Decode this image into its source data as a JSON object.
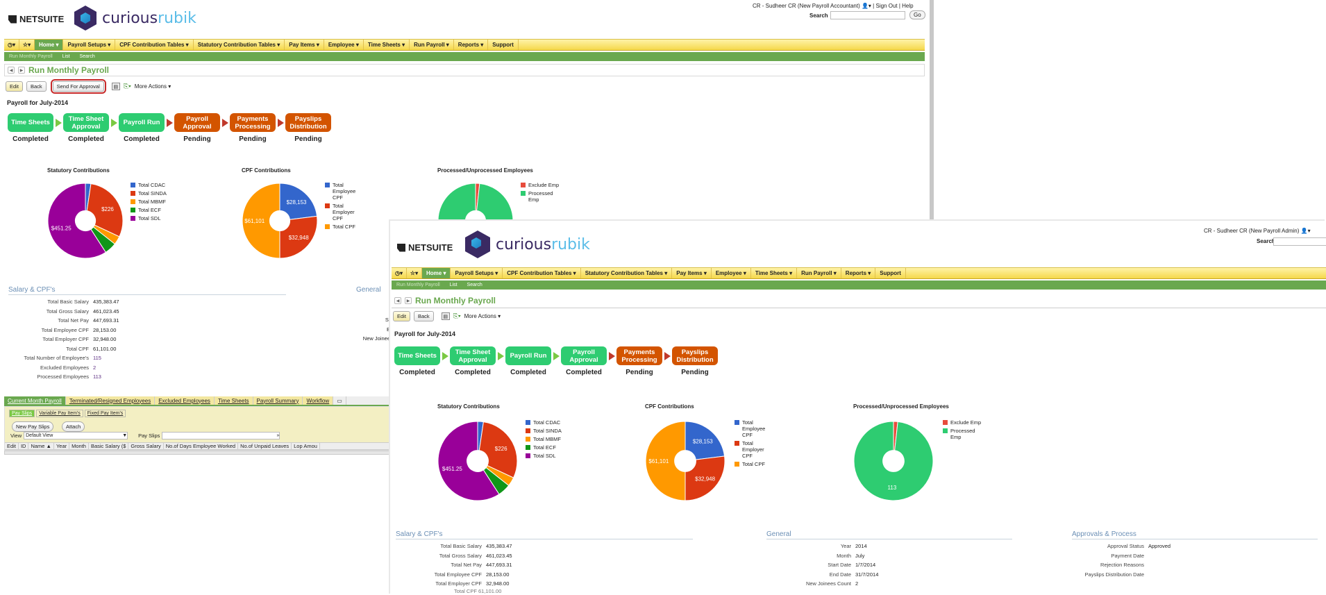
{
  "app": {
    "netsuite_label": "NETSUITE",
    "brand_left": "curious",
    "brand_right": "rubik"
  },
  "win1": {
    "user": "CR - Sudheer CR (New Payroll Accountant)",
    "sign_out": "Sign Out",
    "help": "Help",
    "search_label": "Search",
    "go": "Go"
  },
  "win2": {
    "user": "CR - Sudheer CR (New Payroll Admin)",
    "search_label": "Search"
  },
  "menu": {
    "home": "Home ▾",
    "items": [
      "Payroll Setups ▾",
      "CPF Contribution Tables ▾",
      "Statutory Contribution Tables ▾",
      "Pay Items ▾",
      "Employee ▾",
      "Time Sheets ▾",
      "Run Payroll ▾",
      "Reports ▾",
      "Support"
    ]
  },
  "submenu": {
    "current": "Run Monthly Payroll",
    "list": "List",
    "search": "Search"
  },
  "page": {
    "title": "Run Monthly Payroll",
    "edit": "Edit",
    "back": "Back",
    "send_for_approval": "Send For Approval",
    "more_actions": "More Actions ▾",
    "payroll_for": "Payroll for July-2014"
  },
  "workflow": [
    {
      "name": "Time Sheets",
      "status": "Completed",
      "state": "done"
    },
    {
      "name": "Time Sheet Approval",
      "status": "Completed",
      "state": "done"
    },
    {
      "name": "Payroll Run",
      "status": "Completed",
      "state": "done"
    },
    {
      "name": "Payroll Approval",
      "status": "Pending",
      "state": "pending"
    },
    {
      "name": "Payments Processing",
      "status": "Pending",
      "state": "pending"
    },
    {
      "name": "Payslips Distribution",
      "status": "Pending",
      "state": "pending"
    }
  ],
  "workflow_win2": [
    {
      "name": "Time Sheets",
      "status": "Completed",
      "state": "done"
    },
    {
      "name": "Time Sheet Approval",
      "status": "Completed",
      "state": "done"
    },
    {
      "name": "Payroll Run",
      "status": "Completed",
      "state": "done"
    },
    {
      "name": "Payroll Approval",
      "status": "Completed",
      "state": "done"
    },
    {
      "name": "Payments Processing",
      "status": "Pending",
      "state": "pending"
    },
    {
      "name": "Payslips Distribution",
      "status": "Pending",
      "state": "pending"
    }
  ],
  "colors": {
    "green_step": "#2ecc71",
    "orange_step": "#d35400",
    "menu_active": "#6aa84f"
  },
  "chart_data": [
    {
      "type": "pie",
      "title": "Statutory Contributions",
      "categories": [
        "Total CDAC",
        "Total SINDA",
        "Total MBMF",
        "Total ECF",
        "Total SDL"
      ],
      "values": [
        18,
        226,
        28,
        40,
        451.25
      ],
      "colors": [
        "#3366cc",
        "#dc3912",
        "#ff9900",
        "#109618",
        "#990099"
      ],
      "data_labels": {
        "1": "$226",
        "4": "$451.25"
      },
      "legend": "right"
    },
    {
      "type": "pie",
      "title": "CPF Contributions",
      "categories": [
        "Total Employee CPF",
        "Total Employer CPF",
        "Total CPF"
      ],
      "legend_labels": [
        [
          "Total",
          "Employee",
          "CPF"
        ],
        [
          "Total",
          "Employer",
          "CPF"
        ],
        [
          "Total CPF"
        ]
      ],
      "values": [
        28153,
        32948,
        61101
      ],
      "colors": [
        "#3366cc",
        "#dc3912",
        "#ff9900"
      ],
      "data_labels": {
        "0": "$28,153",
        "1": "$32,948",
        "2": "$61,101"
      },
      "legend": "right"
    },
    {
      "type": "pie",
      "title": "Processed/Unprocessed Employees",
      "categories": [
        "Exclude Emp",
        "Processed Emp"
      ],
      "legend_labels": [
        [
          "Exclude Emp"
        ],
        [
          "Processed",
          "Emp"
        ]
      ],
      "values": [
        2,
        113
      ],
      "colors": [
        "#e74c3c",
        "#2ecc71"
      ],
      "data_labels": {
        "1": "113"
      },
      "legend": "right"
    }
  ],
  "salary": {
    "title": "Salary & CPF's",
    "rows": [
      {
        "k": "Total Basic Salary",
        "v": "435,383.47"
      },
      {
        "k": "Total Gross Salary",
        "v": "461,023.45"
      },
      {
        "k": "Total Net Pay",
        "v": "447,693.31"
      },
      {
        "k": "Total Employee CPF",
        "v": "28,153.00"
      },
      {
        "k": "Total Employer CPF",
        "v": "32,948.00"
      },
      {
        "k": "Total CPF",
        "v": "61,101.00"
      },
      {
        "k": "Total Number of Employee's",
        "v": "115"
      },
      {
        "k": "Excluded Employees",
        "v": "2"
      },
      {
        "k": "Processed Employees",
        "v": "113"
      }
    ],
    "partial_last": "Total CPF  61,101.00"
  },
  "general": {
    "title": "General",
    "rows": [
      {
        "k": "Year",
        "v": "2014"
      },
      {
        "k": "Month",
        "v": "July"
      },
      {
        "k": "Start Date",
        "v": "1/7/2014"
      },
      {
        "k": "End Date",
        "v": "31/7/2014"
      },
      {
        "k": "New Joinees Count",
        "v": "2"
      }
    ],
    "win1_fragments": [
      "St",
      "E",
      "New Joinee"
    ]
  },
  "approvals": {
    "title": "Approvals & Process",
    "rows": [
      {
        "k": "Approval Status",
        "v": "Approved"
      },
      {
        "k": "Payment Date",
        "v": ""
      },
      {
        "k": "Rejection Reasons",
        "v": ""
      },
      {
        "k": "Payslips Distribution Date",
        "v": ""
      }
    ]
  },
  "sublist": {
    "tabs": [
      "Current Month Payroll",
      "Terminated/Resigned Employees",
      "Excluded Employees",
      "Time Sheets",
      "Payroll Summary",
      "Workflow"
    ],
    "subtabs": [
      "Pay Slips",
      "Variable Pay Item's",
      "Fixed Pay Item's"
    ],
    "new_pay_slips": "New Pay Slips",
    "attach": "Attach",
    "view_label": "View",
    "view_value": "Default View",
    "pay_slips_label": "Pay Slips",
    "columns": [
      "Edit",
      "ID",
      "Name ▲",
      "Year",
      "Month",
      "Basic Salary ($",
      "Gross Salary",
      "No.of Days Employee Worked",
      "No.of Unpaid Leaves",
      "Lop Amou"
    ]
  }
}
